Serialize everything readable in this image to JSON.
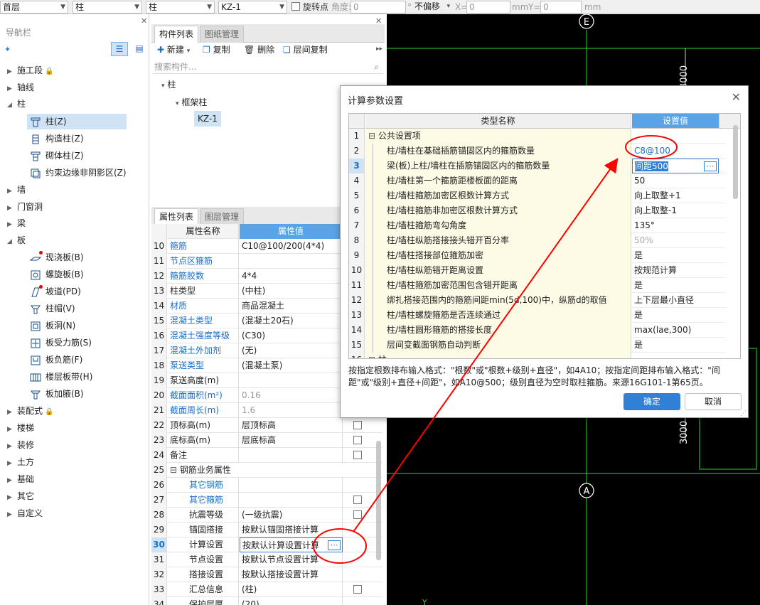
{
  "toolbar": {
    "floor": "首层",
    "category": "柱",
    "type": "柱",
    "component": "KZ-1",
    "rotate_label": "旋转点",
    "angle_label": "角度:",
    "angle_value": "0",
    "degree_sym": "°",
    "offset_mode": "不偏移",
    "x_label": "X=",
    "x_value": "0",
    "mm1": "mm",
    "y_label": "Y=",
    "y_value": "0",
    "mm2": "mm"
  },
  "nav": {
    "title": "导航栏",
    "groups": [
      {
        "label": "施工段",
        "lock": true
      },
      {
        "label": "轴线"
      },
      {
        "label": "柱",
        "open": true
      },
      {
        "label": "墙"
      },
      {
        "label": "门窗洞"
      },
      {
        "label": "梁"
      },
      {
        "label": "板",
        "open": true
      },
      {
        "label": "装配式",
        "lock": true
      },
      {
        "label": "楼梯"
      },
      {
        "label": "装修"
      },
      {
        "label": "土方"
      },
      {
        "label": "基础"
      },
      {
        "label": "其它"
      },
      {
        "label": "自定义"
      }
    ],
    "column_items": [
      "柱(Z)",
      "构造柱(Z)",
      "砌体柱(Z)",
      "约束边缘非阴影区(Z)"
    ],
    "slab_items": [
      "现浇板(B)",
      "螺旋板(B)",
      "坡道(PD)",
      "柱帽(V)",
      "板洞(N)",
      "板受力筋(S)",
      "板负筋(F)",
      "楼层板带(H)",
      "板加腋(B)"
    ]
  },
  "components": {
    "tab_active": "构件列表",
    "tab_inactive": "图纸管理",
    "new": "新建",
    "copy": "复制",
    "delete": "删除",
    "floor_copy": "层间复制",
    "search_placeholder": "搜索构件...",
    "tree_root": "柱",
    "tree_group": "框架柱",
    "tree_item": "KZ-1"
  },
  "properties": {
    "tab_active": "属性列表",
    "tab_inactive": "图层管理",
    "col_name": "属性名称",
    "col_value": "属性值",
    "rows": [
      {
        "n": "10",
        "k": "箍筋",
        "v": "C10@100/200(4*4)",
        "kc": "blue"
      },
      {
        "n": "11",
        "k": "节点区箍筋",
        "v": "",
        "kc": "blue"
      },
      {
        "n": "12",
        "k": "箍筋胶数",
        "v": "4*4",
        "kc": "blue"
      },
      {
        "n": "13",
        "k": "柱类型",
        "v": "(中柱)"
      },
      {
        "n": "14",
        "k": "材质",
        "v": "商品混凝土",
        "kc": "blue"
      },
      {
        "n": "15",
        "k": "混凝土类型",
        "v": "(混凝土20石)",
        "kc": "blue"
      },
      {
        "n": "16",
        "k": "混凝土强度等级",
        "v": "(C30)",
        "kc": "blue"
      },
      {
        "n": "17",
        "k": "混凝土外加剂",
        "v": "(无)",
        "kc": "blue"
      },
      {
        "n": "18",
        "k": "泵送类型",
        "v": "(混凝土泵)",
        "kc": "blue"
      },
      {
        "n": "19",
        "k": "泵送高度(m)",
        "v": ""
      },
      {
        "n": "20",
        "k": "截面面积(m²)",
        "v": "0.16",
        "kc": "blue",
        "vc": "gray"
      },
      {
        "n": "21",
        "k": "截面周长(m)",
        "v": "1.6",
        "kc": "blue",
        "vc": "gray"
      },
      {
        "n": "22",
        "k": "顶标高(m)",
        "v": "层顶标高",
        "cb": true
      },
      {
        "n": "23",
        "k": "底标高(m)",
        "v": "层底标高",
        "cb": true
      },
      {
        "n": "24",
        "k": "备注",
        "v": "",
        "cb": true
      },
      {
        "n": "25",
        "k": "钢筋业务属性",
        "v": "",
        "group": true
      },
      {
        "n": "26",
        "k": "其它钢筋",
        "v": "",
        "kc": "blue",
        "indent": true
      },
      {
        "n": "27",
        "k": "其它箍筋",
        "v": "",
        "kc": "blue",
        "indent": true,
        "cb": true
      },
      {
        "n": "28",
        "k": "抗震等级",
        "v": "(一级抗震)",
        "indent": true,
        "cb": true
      },
      {
        "n": "29",
        "k": "锚固搭接",
        "v": "按默认锚固搭接计算",
        "indent": true
      },
      {
        "n": "30",
        "k": "计算设置",
        "v": "按默认计算设置计算",
        "indent": true,
        "active": true
      },
      {
        "n": "31",
        "k": "节点设置",
        "v": "按默认节点设置计算",
        "indent": true
      },
      {
        "n": "32",
        "k": "搭接设置",
        "v": "按默认搭接设置计算",
        "indent": true
      },
      {
        "n": "33",
        "k": "汇总信息",
        "v": "(柱)",
        "indent": true,
        "cb": true
      },
      {
        "n": "34",
        "k": "保护层厚",
        "v": "(20)",
        "indent": true
      }
    ]
  },
  "canvas": {
    "axis_top": "E",
    "axis_bottom": "A",
    "dim_top": "3000",
    "dim_bottom": "3000",
    "y_label": "Y"
  },
  "dialog": {
    "title": "计算参数设置",
    "col_name": "类型名称",
    "col_value": "设置值",
    "rows": [
      {
        "n": "1",
        "k": "公共设置项",
        "v": "",
        "group": true
      },
      {
        "n": "2",
        "k": "柱/墙柱在基础插筋锚固区内的箍筋数量",
        "v": "C8@100",
        "vc": "blue"
      },
      {
        "n": "3",
        "k": "梁(板)上柱/墙柱在插筋锚固区内的箍筋数量",
        "v": "间距500",
        "active": true
      },
      {
        "n": "4",
        "k": "柱/墙柱第一个箍筋距楼板面的距离",
        "v": "50"
      },
      {
        "n": "5",
        "k": "柱/墙柱箍筋加密区根数计算方式",
        "v": "向上取整+1"
      },
      {
        "n": "6",
        "k": "柱/墙柱箍筋非加密区根数计算方式",
        "v": "向上取整-1"
      },
      {
        "n": "7",
        "k": "柱/墙柱箍筋弯勾角度",
        "v": "135°"
      },
      {
        "n": "8",
        "k": "柱/墙柱纵筋搭接接头错开百分率",
        "v": "50%",
        "vc": "gray"
      },
      {
        "n": "9",
        "k": "柱/墙柱搭接部位箍筋加密",
        "v": "是"
      },
      {
        "n": "10",
        "k": "柱/墙柱纵筋错开距离设置",
        "v": "按规范计算"
      },
      {
        "n": "11",
        "k": "柱/墙柱箍筋加密范围包含错开距离",
        "v": "是"
      },
      {
        "n": "12",
        "k": "绑扎搭接范围内的箍筋间距min(5d,100)中，纵筋d的取值",
        "v": "上下层最小直径"
      },
      {
        "n": "13",
        "k": "柱/墙柱螺旋箍筋是否连续通过",
        "v": "是"
      },
      {
        "n": "14",
        "k": "柱/墙柱圆形箍筋的搭接长度",
        "v": "max(lae,300)"
      },
      {
        "n": "15",
        "k": "层间变截面钢筋自动判断",
        "v": "是"
      },
      {
        "n": "16",
        "k": "柱",
        "v": "",
        "group": true
      }
    ],
    "help": "按指定根数排布输入格式：\"根数\"或\"根数+级别+直径\"，如4A10；按指定间距排布输入格式：\"间距\"或\"级别+直径+间距\"，如A10@500；级别直径为空时取柱箍筋。来源16G101-1第65页。",
    "ok": "确定",
    "cancel": "取消"
  },
  "colors": {
    "accent": "#2f80d6",
    "selection": "#cfe3f5",
    "annotation": "#ff0000",
    "canvas_bg": "#000000",
    "axis_green": "#2dd62d"
  }
}
